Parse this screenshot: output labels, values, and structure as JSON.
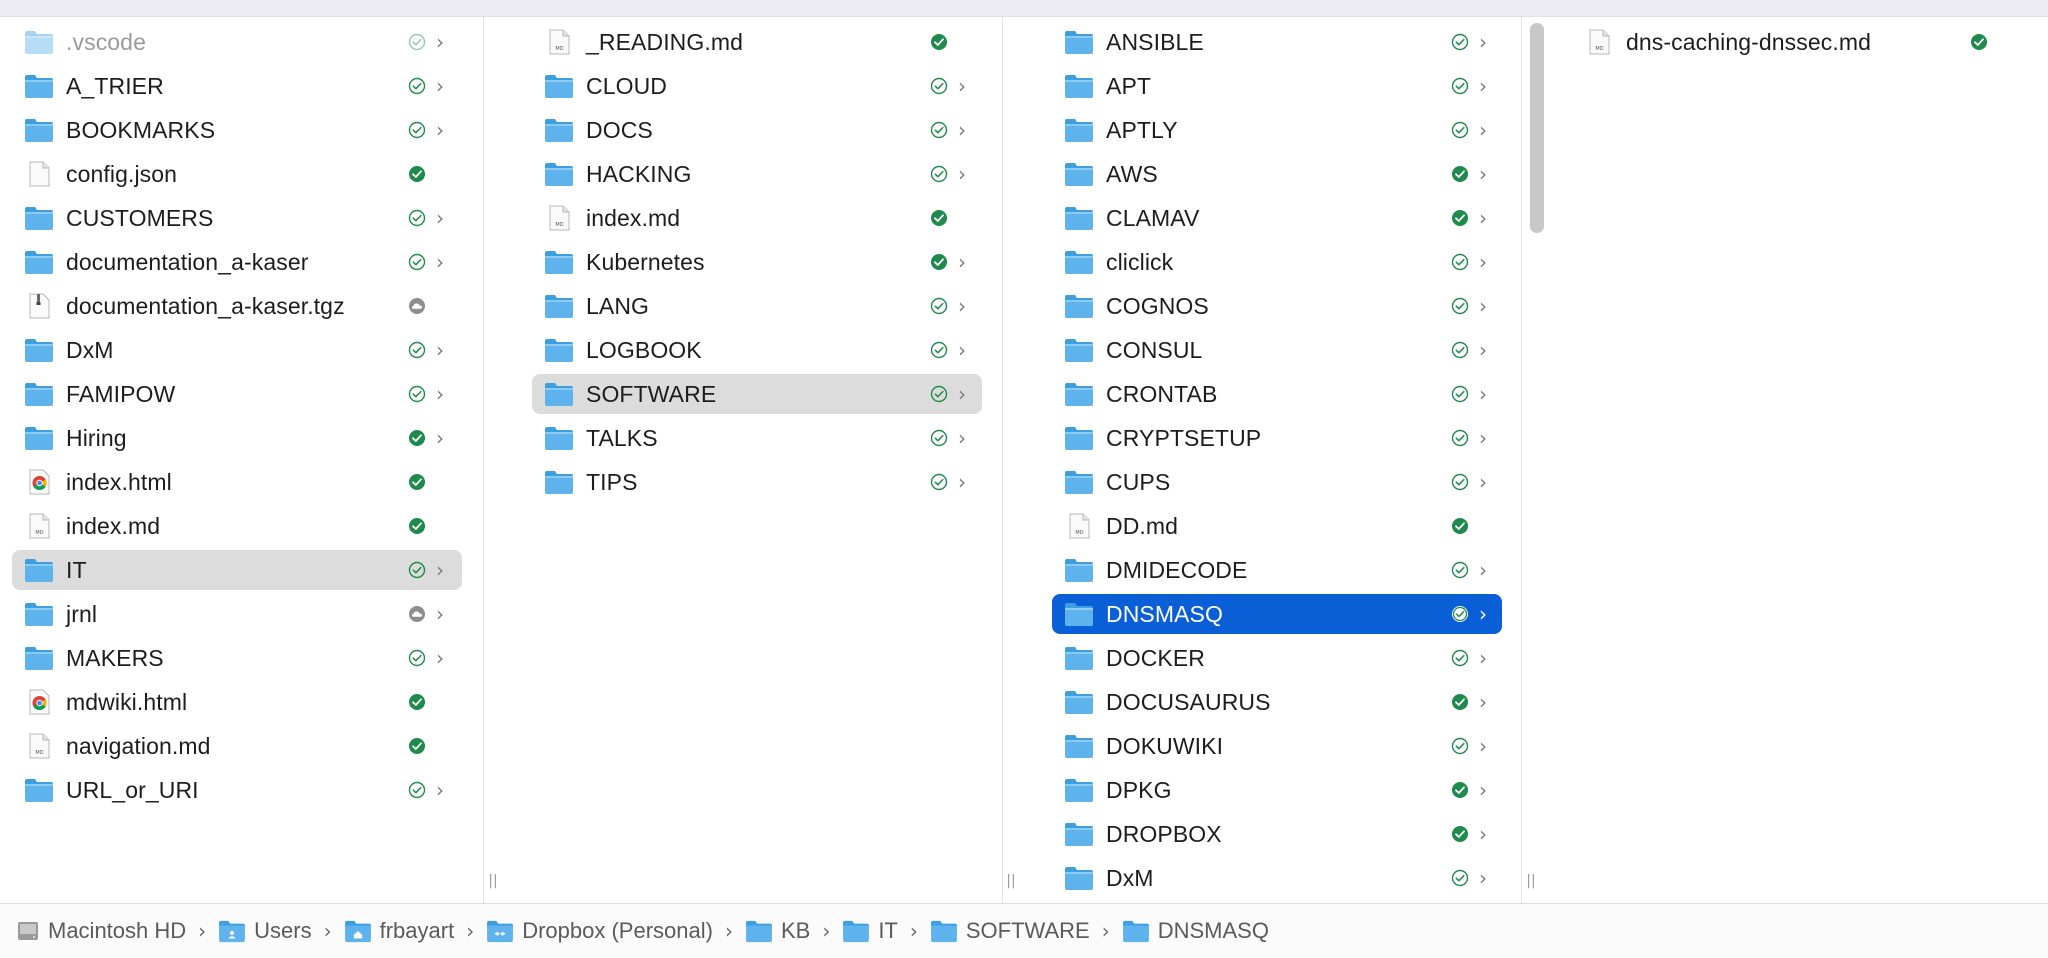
{
  "columns": [
    {
      "items": [
        {
          "label": ".vscode",
          "kind": "folder-faded",
          "status": "outline-faded",
          "chevron": true,
          "dim": true
        },
        {
          "label": "A_TRIER",
          "kind": "folder",
          "status": "outline",
          "chevron": true
        },
        {
          "label": "BOOKMARKS",
          "kind": "folder",
          "status": "outline",
          "chevron": true
        },
        {
          "label": "config.json",
          "kind": "file",
          "status": "filled",
          "chevron": false
        },
        {
          "label": "CUSTOMERS",
          "kind": "folder",
          "status": "outline",
          "chevron": true
        },
        {
          "label": "documentation_a-kaser",
          "kind": "folder",
          "status": "outline",
          "chevron": true
        },
        {
          "label": "documentation_a-kaser.tgz",
          "kind": "archive",
          "status": "cloud",
          "chevron": false
        },
        {
          "label": "DxM",
          "kind": "folder",
          "status": "outline",
          "chevron": true
        },
        {
          "label": "FAMIPOW",
          "kind": "folder",
          "status": "outline",
          "chevron": true
        },
        {
          "label": "Hiring",
          "kind": "folder",
          "status": "filled",
          "chevron": true
        },
        {
          "label": "index.html",
          "kind": "chrome",
          "status": "filled",
          "chevron": false
        },
        {
          "label": "index.md",
          "kind": "md",
          "status": "filled",
          "chevron": false
        },
        {
          "label": "IT",
          "kind": "folder",
          "status": "outline",
          "chevron": true,
          "selected": "gray"
        },
        {
          "label": "jrnl",
          "kind": "folder",
          "status": "cloud",
          "chevron": true
        },
        {
          "label": "MAKERS",
          "kind": "folder",
          "status": "outline",
          "chevron": true
        },
        {
          "label": "mdwiki.html",
          "kind": "chrome",
          "status": "filled",
          "chevron": false
        },
        {
          "label": "navigation.md",
          "kind": "md",
          "status": "filled",
          "chevron": false
        },
        {
          "label": "URL_or_URI",
          "kind": "folder",
          "status": "outline",
          "chevron": true
        }
      ]
    },
    {
      "items": [
        {
          "label": "_READING.md",
          "kind": "md",
          "status": "filled",
          "chevron": false
        },
        {
          "label": "CLOUD",
          "kind": "folder",
          "status": "outline",
          "chevron": true
        },
        {
          "label": "DOCS",
          "kind": "folder",
          "status": "outline",
          "chevron": true
        },
        {
          "label": "HACKING",
          "kind": "folder",
          "status": "outline",
          "chevron": true
        },
        {
          "label": "index.md",
          "kind": "md",
          "status": "filled",
          "chevron": false
        },
        {
          "label": "Kubernetes",
          "kind": "folder",
          "status": "filled",
          "chevron": true
        },
        {
          "label": "LANG",
          "kind": "folder",
          "status": "outline",
          "chevron": true
        },
        {
          "label": "LOGBOOK",
          "kind": "folder",
          "status": "outline",
          "chevron": true
        },
        {
          "label": "SOFTWARE",
          "kind": "folder",
          "status": "outline",
          "chevron": true,
          "selected": "gray"
        },
        {
          "label": "TALKS",
          "kind": "folder",
          "status": "outline",
          "chevron": true
        },
        {
          "label": "TIPS",
          "kind": "folder",
          "status": "outline",
          "chevron": true
        }
      ]
    },
    {
      "items": [
        {
          "label": "ANSIBLE",
          "kind": "folder",
          "status": "outline",
          "chevron": true
        },
        {
          "label": "APT",
          "kind": "folder",
          "status": "outline",
          "chevron": true
        },
        {
          "label": "APTLY",
          "kind": "folder",
          "status": "outline",
          "chevron": true
        },
        {
          "label": "AWS",
          "kind": "folder",
          "status": "filled",
          "chevron": true
        },
        {
          "label": "CLAMAV",
          "kind": "folder",
          "status": "filled",
          "chevron": true
        },
        {
          "label": "cliclick",
          "kind": "folder",
          "status": "outline",
          "chevron": true
        },
        {
          "label": "COGNOS",
          "kind": "folder",
          "status": "outline",
          "chevron": true
        },
        {
          "label": "CONSUL",
          "kind": "folder",
          "status": "outline",
          "chevron": true
        },
        {
          "label": "CRONTAB",
          "kind": "folder",
          "status": "outline",
          "chevron": true
        },
        {
          "label": "CRYPTSETUP",
          "kind": "folder",
          "status": "outline",
          "chevron": true
        },
        {
          "label": "CUPS",
          "kind": "folder",
          "status": "outline",
          "chevron": true
        },
        {
          "label": "DD.md",
          "kind": "md",
          "status": "filled",
          "chevron": false
        },
        {
          "label": "DMIDECODE",
          "kind": "folder",
          "status": "outline",
          "chevron": true
        },
        {
          "label": "DNSMASQ",
          "kind": "folder",
          "status": "outline-white",
          "chevron": true,
          "selected": "blue"
        },
        {
          "label": "DOCKER",
          "kind": "folder",
          "status": "outline",
          "chevron": true
        },
        {
          "label": "DOCUSAURUS",
          "kind": "folder",
          "status": "filled",
          "chevron": true
        },
        {
          "label": "DOKUWIKI",
          "kind": "folder",
          "status": "outline",
          "chevron": true
        },
        {
          "label": "DPKG",
          "kind": "folder",
          "status": "filled",
          "chevron": true
        },
        {
          "label": "DROPBOX",
          "kind": "folder",
          "status": "filled",
          "chevron": true
        },
        {
          "label": "DxM",
          "kind": "folder",
          "status": "outline",
          "chevron": true
        }
      ]
    },
    {
      "items": [
        {
          "label": "dns-caching-dnssec.md",
          "kind": "md",
          "status": "filled",
          "chevron": false
        }
      ]
    }
  ],
  "pathbar": [
    {
      "label": "Macintosh HD",
      "icon": "hard-drive-icon"
    },
    {
      "label": "Users",
      "icon": "users-folder-icon"
    },
    {
      "label": "frbayart",
      "icon": "home-folder-icon"
    },
    {
      "label": "Dropbox (Personal)",
      "icon": "dropbox-folder-icon"
    },
    {
      "label": "KB",
      "icon": "folder-icon"
    },
    {
      "label": "IT",
      "icon": "folder-icon"
    },
    {
      "label": "SOFTWARE",
      "icon": "folder-icon"
    },
    {
      "label": "DNSMASQ",
      "icon": "folder-icon"
    }
  ],
  "colors": {
    "folder_body": "#5eb3ec",
    "folder_tab": "#3d9ee0",
    "sync_green": "#1e8a4c",
    "selection_blue": "#0a5fd6",
    "selection_gray": "#dcdcdc"
  }
}
